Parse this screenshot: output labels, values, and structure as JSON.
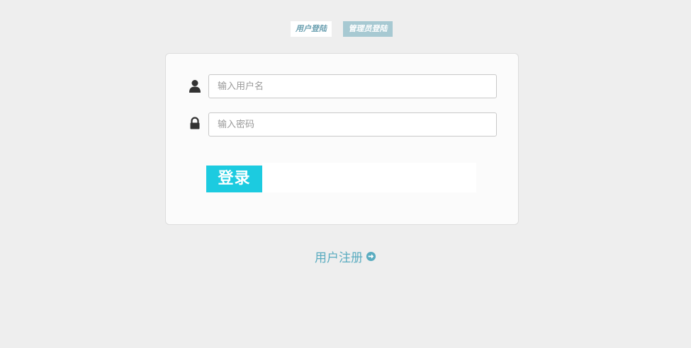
{
  "tabs": {
    "user_login": "用户登陆",
    "admin_login": "管理员登陆"
  },
  "form": {
    "username_placeholder": "输入用户名",
    "password_placeholder": "输入密码",
    "login_label": "登录"
  },
  "register": {
    "label": "用户注册"
  },
  "icons": {
    "username": "user-icon",
    "password": "lock-icon",
    "register": "arrow-circle-right-icon"
  },
  "colors": {
    "background": "#eeeeee",
    "accent": "#1ccbe0",
    "link": "#5aacc0",
    "tab_active": "#a7c9d2"
  }
}
